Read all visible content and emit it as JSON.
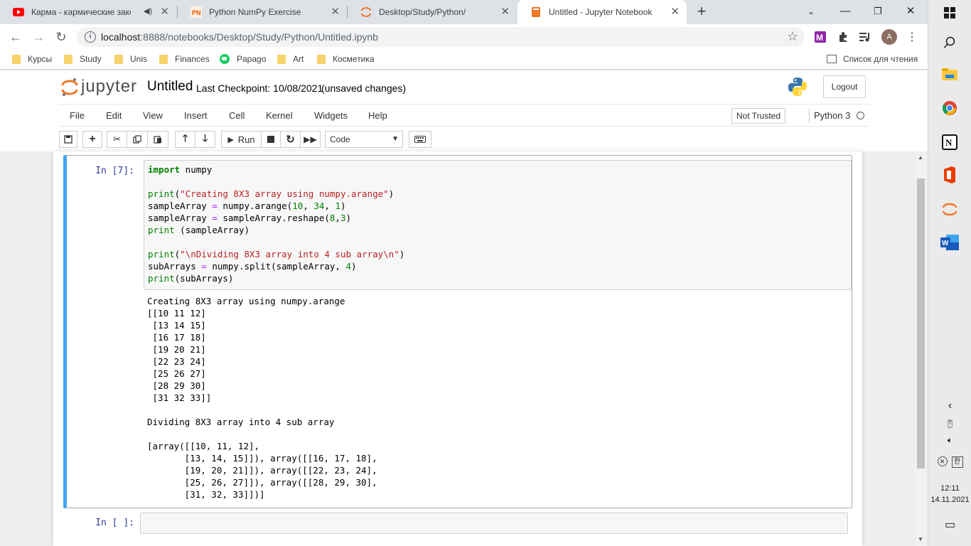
{
  "browser": {
    "tabs": [
      {
        "title": "Карма - кармические закон",
        "icon": "youtube-icon",
        "muted": true
      },
      {
        "title": "Python NumPy Exercise",
        "icon": "pynative-icon"
      },
      {
        "title": "Desktop/Study/Python/",
        "icon": "jupyter-icon"
      },
      {
        "title": "Untitled - Jupyter Notebook",
        "icon": "notebook-icon",
        "active": true
      }
    ],
    "url_host": "localhost",
    "url_rest": ":8888/notebooks/Desktop/Study/Python/Untitled.ipynb",
    "profile_initial": "A",
    "bookmarks": [
      "Курсы",
      "Study",
      "Unis",
      "Finances",
      "Papago",
      "Art",
      "Косметика"
    ],
    "reading_list": "Список для чтения"
  },
  "jupyter": {
    "logo_text": "jupyter",
    "notebook_name": "Untitled",
    "checkpoint": "Last Checkpoint: 10/08/2021",
    "unsaved": "(unsaved changes)",
    "logout": "Logout",
    "menu": [
      "File",
      "Edit",
      "View",
      "Insert",
      "Cell",
      "Kernel",
      "Widgets",
      "Help"
    ],
    "trust": "Not Trusted",
    "kernel": "Python 3",
    "run_label": "Run",
    "cell_type": "Code"
  },
  "cells": [
    {
      "prompt": "In [7]:",
      "output": "Creating 8X3 array using numpy.arange\n[[10 11 12]\n [13 14 15]\n [16 17 18]\n [19 20 21]\n [22 23 24]\n [25 26 27]\n [28 29 30]\n [31 32 33]]\n\nDividing 8X3 array into 4 sub array\n\n[array([[10, 11, 12],\n       [13, 14, 15]]), array([[16, 17, 18],\n       [19, 20, 21]]), array([[22, 23, 24],\n       [25, 26, 27]]), array([[28, 29, 30],\n       [31, 32, 33]])]"
    },
    {
      "prompt": "In [ ]:",
      "source": ""
    }
  ],
  "code_tokens": {
    "l1": [
      "import",
      " numpy"
    ],
    "l3": [
      "print",
      "(",
      "\"Creating 8X3 array using numpy.arange\"",
      ")"
    ],
    "l4": [
      "sampleArray ",
      "=",
      " numpy.arange(",
      "10",
      ", ",
      "34",
      ", ",
      "1",
      ")"
    ],
    "l5": [
      "sampleArray ",
      "=",
      " sampleArray.reshape(",
      "8",
      ",",
      "3",
      ")"
    ],
    "l6": [
      "print",
      " (sampleArray)"
    ],
    "l8": [
      "print",
      "(",
      "\"\\nDividing 8X3 array into 4 sub array\\n\"",
      ")"
    ],
    "l9": [
      "subArrays ",
      "=",
      " numpy.split(sampleArray, ",
      "4",
      ")"
    ],
    "l10": [
      "print",
      "(subArrays)"
    ]
  },
  "system": {
    "time": "12:11",
    "date": "14.11.2021"
  },
  "colors": {
    "accent_jupyter": "#f37726",
    "cell_selected_border": "#42a5f5",
    "prompt_in": "#303f9f"
  }
}
